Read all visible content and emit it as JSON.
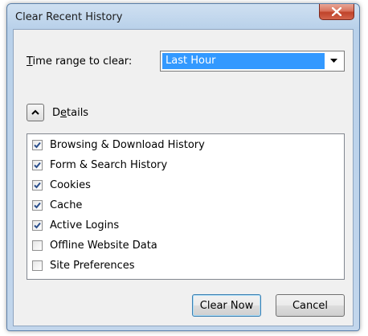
{
  "dialog": {
    "title": "Clear Recent History"
  },
  "time_range": {
    "label_accel": "T",
    "label_rest": "ime range to clear:",
    "selected": "Last Hour"
  },
  "details": {
    "label_pre": "D",
    "label_accel": "e",
    "label_rest": "tails",
    "expanded": true
  },
  "items": [
    {
      "label": "Browsing & Download History",
      "checked": true
    },
    {
      "label": "Form & Search History",
      "checked": true
    },
    {
      "label": "Cookies",
      "checked": true
    },
    {
      "label": "Cache",
      "checked": true
    },
    {
      "label": "Active Logins",
      "checked": true
    },
    {
      "label": "Offline Website Data",
      "checked": false
    },
    {
      "label": "Site Preferences",
      "checked": false
    }
  ],
  "buttons": {
    "clear_now": "Clear Now",
    "cancel": "Cancel"
  },
  "colors": {
    "selection": "#3399ff",
    "close": "#c0432a"
  },
  "icons": {
    "close": "close-icon",
    "dropdown": "chevron-down-icon",
    "details_toggle": "chevron-up-icon",
    "checkmark": "checkmark-icon"
  }
}
